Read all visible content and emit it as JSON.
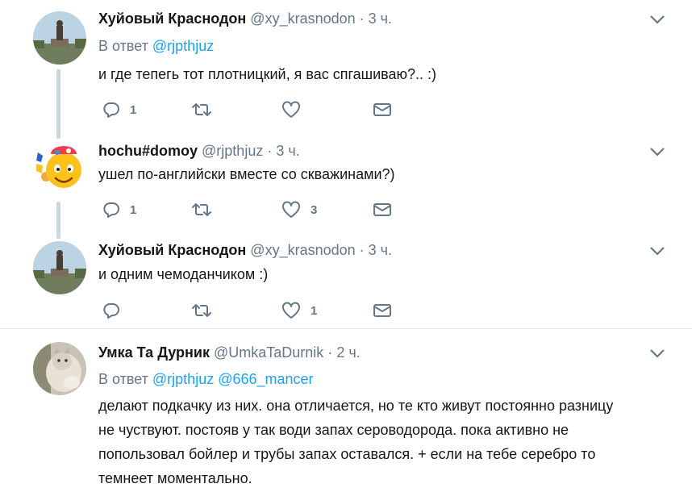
{
  "tweets": [
    {
      "name": "Хуйовый Краснодон",
      "handle": "@xy_krasnodon",
      "dot": "·",
      "time": "3 ч.",
      "reply_prefix": "В ответ",
      "reply_to": "@rjpthjuz",
      "text": "и где тепегь тот плотницкий, я вас спгашиваю?.. :)",
      "replies": "1",
      "retweets": "",
      "likes": "",
      "avatar_icon": "monument-photo"
    },
    {
      "name": "hochu#domoy",
      "handle": "@rjpthjuz",
      "dot": "·",
      "time": "3 ч.",
      "text": "ушел по-английски вместе со скважинами?)",
      "replies": "1",
      "retweets": "",
      "likes": "3",
      "avatar_icon": "emoji-face"
    },
    {
      "name": "Хуйовый Краснодон",
      "handle": "@xy_krasnodon",
      "dot": "·",
      "time": "3 ч.",
      "text": "и одним чемоданчиком :)",
      "replies": "",
      "retweets": "",
      "likes": "1",
      "avatar_icon": "monument-photo"
    },
    {
      "name": "Умка Та Дурник",
      "handle": "@UmkaTaDurnik",
      "dot": "·",
      "time": "2 ч.",
      "reply_prefix": "В ответ",
      "reply_to": "@rjpthjuz @666_mancer",
      "text_lines": [
        "делают подкачку из них. она отличается, но те кто живут постоянно разницу",
        "не чуствуют. постояв у так води запах сероводорода. пока активно не",
        "попользовал бойлер и трубы запах оставался. + если на тебе серебро то",
        "темнеет моментально."
      ],
      "avatar_icon": "cat-photo"
    }
  ],
  "colors": {
    "link": "#1da1f2",
    "muted": "#657786",
    "line": "#ccd6dd"
  }
}
